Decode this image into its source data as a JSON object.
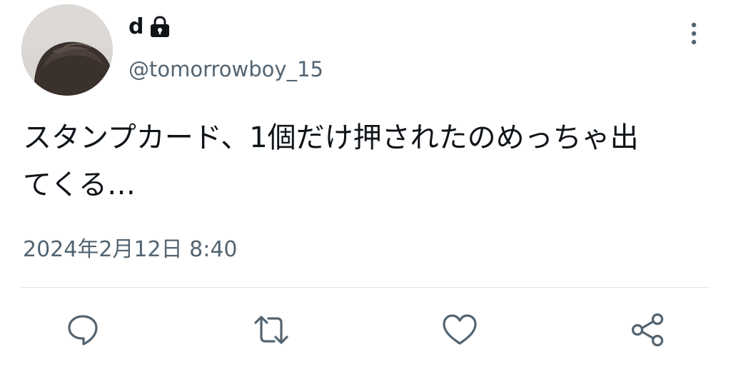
{
  "tweet": {
    "author": {
      "display_name": "d",
      "handle": "@tomorrowboy_15",
      "protected": true
    },
    "text_lines": [
      "スタンプカード、1個だけ押されたのめっちゃ出",
      "てくる…"
    ],
    "timestamp": "2024年2月12日 8:40"
  },
  "icons": {
    "lock": "lock-icon",
    "more": "more-vertical-icon",
    "reply": "reply-icon",
    "retweet": "retweet-icon",
    "like": "heart-icon",
    "share": "share-icon"
  },
  "colors": {
    "text_primary": "#0f1419",
    "text_secondary": "#536471",
    "icon": "#536471",
    "divider": "#e1e5e8",
    "background": "#ffffff"
  }
}
